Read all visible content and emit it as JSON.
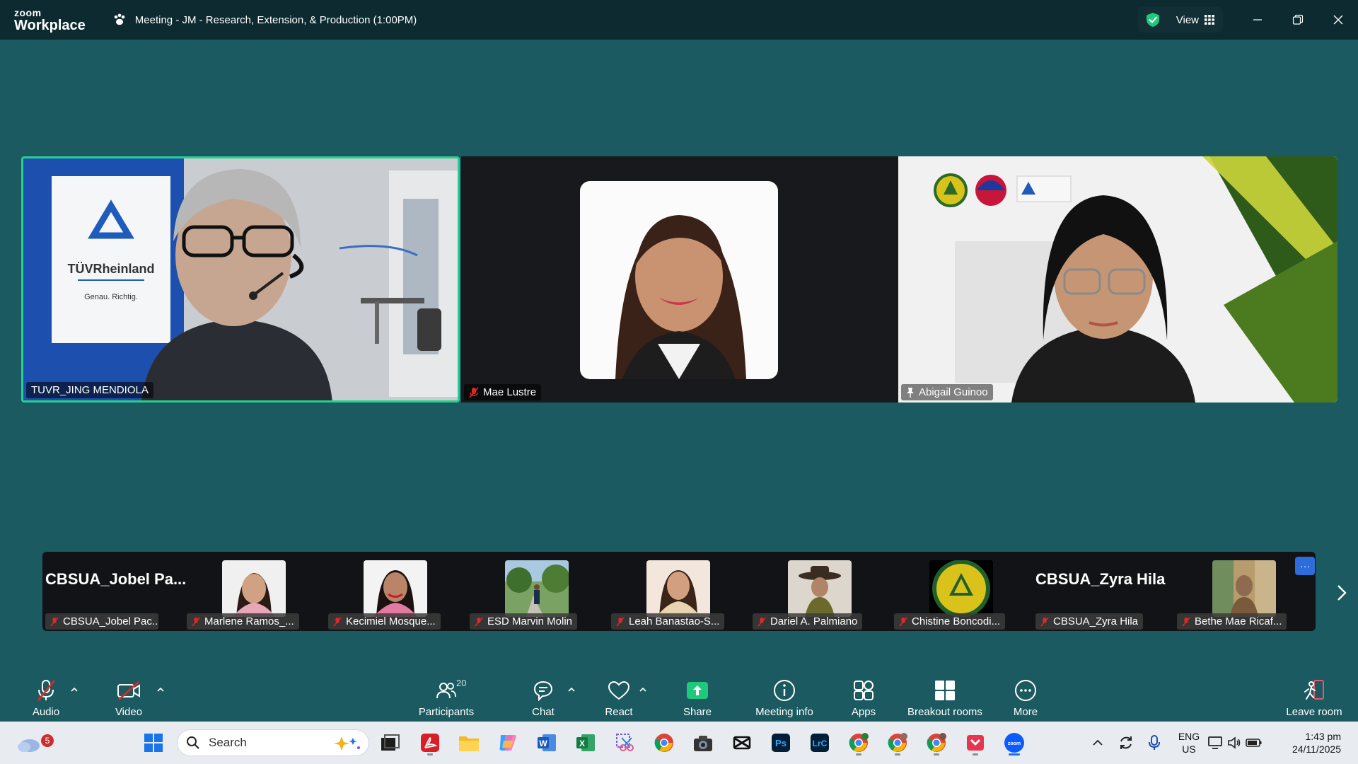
{
  "app": {
    "brand_top": "zoom",
    "brand_bottom": "Workplace"
  },
  "meeting": {
    "title": "Meeting - JM - Research, Extension, & Production (1:00PM)"
  },
  "header": {
    "view_label": "View"
  },
  "main_tiles": [
    {
      "name": "TUVR_JING MENDIOLA",
      "active_speaker": true,
      "muted": false,
      "logo_brand": "TÜVRheinland",
      "logo_tagline": "Genau. Richtig."
    },
    {
      "name": "Mae Lustre",
      "muted": true
    },
    {
      "name": "Abigail Guinoo",
      "pinned": true
    }
  ],
  "gallery": [
    {
      "name": "CBSUA_Jobel Pac...",
      "display_name": "CBSUA_Jobel  Pa...",
      "muted": true
    },
    {
      "name": "Marlene Ramos_...",
      "muted": true
    },
    {
      "name": "Kecimiel Mosque...",
      "muted": true
    },
    {
      "name": "ESD Marvin Molin",
      "muted": true
    },
    {
      "name": "Leah Banastao-S...",
      "muted": true
    },
    {
      "name": "Dariel A. Palmiano",
      "muted": true
    },
    {
      "name": "Chistine Boncodi...",
      "muted": true
    },
    {
      "name": "CBSUA_Zyra Hila",
      "display_name": "CBSUA_Zyra Hila",
      "muted": true
    },
    {
      "name": "Bethe Mae Ricaf...",
      "muted": true
    }
  ],
  "gallery_more": "···",
  "toolbar": {
    "audio": "Audio",
    "video": "Video",
    "participants": "Participants",
    "participants_count": "20",
    "chat": "Chat",
    "react": "React",
    "share": "Share",
    "meeting_info": "Meeting info",
    "apps": "Apps",
    "breakout": "Breakout rooms",
    "more": "More",
    "leave": "Leave room"
  },
  "taskbar": {
    "weather_badge": "5",
    "search_placeholder": "Search",
    "lang_top": "ENG",
    "lang_bottom": "US",
    "time": "1:43 pm",
    "date": "24/11/2025",
    "app_icons": [
      "task-view",
      "acrobat",
      "file-explorer",
      "copilot",
      "word",
      "excel",
      "snipping-tool",
      "chrome",
      "camera",
      "capcut",
      "photoshop",
      "lightroom-classic",
      "chrome-profile-1",
      "chrome-profile-2",
      "chrome-profile-3",
      "pocket",
      "zoom"
    ]
  },
  "colors": {
    "accent_green": "#27d08e",
    "zoom_blue": "#0b5cff",
    "mute_red": "#e02828",
    "share_green": "#1ec97b",
    "background": "#1a5a60"
  }
}
